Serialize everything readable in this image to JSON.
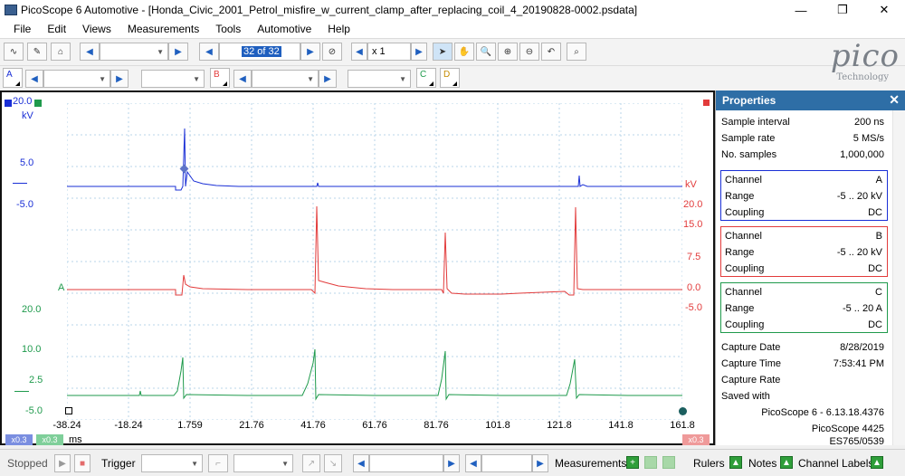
{
  "window": {
    "title": "PicoScope 6 Automotive - [Honda_Civic_2001_Petrol_misfire_w_current_clamp_after_replacing_coil_4_20190828-0002.psdata]",
    "minimize": "—",
    "maximize": "❐",
    "close": "✕"
  },
  "menu": [
    "File",
    "Edit",
    "Views",
    "Measurements",
    "Tools",
    "Automotive",
    "Help"
  ],
  "toolbar": {
    "buffer_position": "32 of 32",
    "zoom": "x 1"
  },
  "channels_bar": {
    "a": "A",
    "b": "B",
    "c": "C",
    "d": "D"
  },
  "logo": {
    "name": "pico",
    "tagline": "Technology"
  },
  "scope": {
    "y_left_blue": [
      "20.0",
      "kV",
      "5.0",
      "-5.0"
    ],
    "y_left_a": "A",
    "y_left_green": [
      "20.0",
      "10.0",
      "2.5",
      "-5.0"
    ],
    "y_right_red": [
      "kV",
      "20.0",
      "15.0",
      "7.5",
      "0.0",
      "-5.0"
    ],
    "x_ticks": [
      "-38.24",
      "-18.24",
      "1.759",
      "21.76",
      "41.76",
      "61.76",
      "81.76",
      "101.8",
      "121.8",
      "141.8",
      "161.8"
    ],
    "x_unit": "ms",
    "zoom_badges": [
      "x0.3",
      "x0.3",
      "x0.3"
    ],
    "colors": {
      "a": "#1a2fd6",
      "b": "#e23b3b",
      "c": "#1f9a4c"
    }
  },
  "properties": {
    "title": "Properties",
    "rows_top": [
      {
        "label": "Sample interval",
        "value": "200 ns"
      },
      {
        "label": "Sample rate",
        "value": "5 MS/s"
      },
      {
        "label": "No. samples",
        "value": "1,000,000"
      }
    ],
    "channels": [
      {
        "channel": "A",
        "range": "-5 .. 20 kV",
        "coupling": "DC",
        "color": "#1a2fd6"
      },
      {
        "channel": "B",
        "range": "-5 .. 20 kV",
        "coupling": "DC",
        "color": "#e23b3b"
      },
      {
        "channel": "C",
        "range": "-5 .. 20 A",
        "coupling": "DC",
        "color": "#1f9a4c"
      }
    ],
    "labels": {
      "channel": "Channel",
      "range": "Range",
      "coupling": "Coupling"
    },
    "capture_date_label": "Capture Date",
    "capture_date": "8/28/2019",
    "capture_time_label": "Capture Time",
    "capture_time": "7:53:41 PM",
    "capture_rate_label": "Capture Rate",
    "saved_with_label": "Saved with",
    "saved_with": [
      "PicoScope 6 - 6.13.18.4376",
      "PicoScope 4425",
      "ES765/0539"
    ]
  },
  "statusbar": {
    "state": "Stopped",
    "trigger": "Trigger",
    "measurements": "Measurements",
    "rulers": "Rulers",
    "notes": "Notes",
    "channel_labels": "Channel Labels"
  }
}
